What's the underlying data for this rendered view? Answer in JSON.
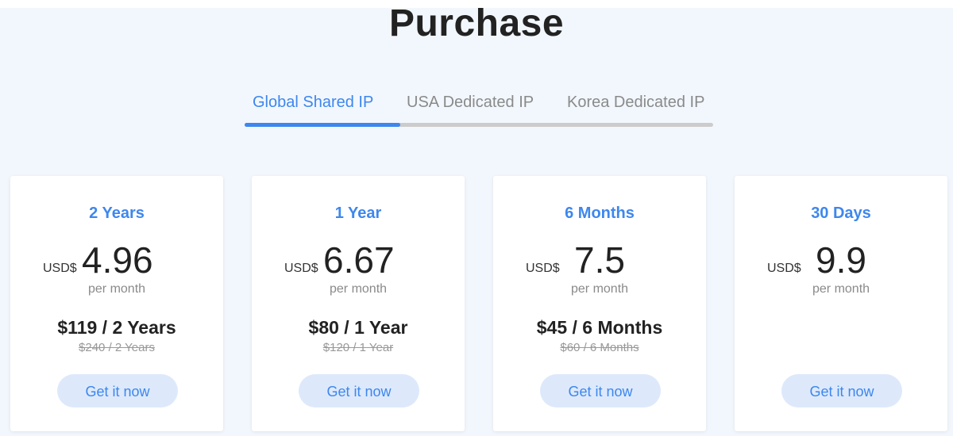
{
  "page": {
    "title": "Purchase"
  },
  "tabs": [
    {
      "label": "Global Shared IP",
      "active": true
    },
    {
      "label": "USA Dedicated IP",
      "active": false
    },
    {
      "label": "Korea Dedicated IP",
      "active": false
    }
  ],
  "colors": {
    "accent": "#3d87ee",
    "button_bg": "#dde9fb",
    "panel_bg": "#f2f7fd"
  },
  "plans": [
    {
      "name": "2 Years",
      "currency": "USD$",
      "amount": "4.96",
      "per": "per month",
      "total": "$119 / 2 Years",
      "original": "$240 / 2 Years",
      "button": "Get it now"
    },
    {
      "name": "1 Year",
      "currency": "USD$",
      "amount": "6.67",
      "per": "per month",
      "total": "$80 / 1 Year",
      "original": "$120 / 1 Year",
      "button": "Get it now"
    },
    {
      "name": "6 Months",
      "currency": "USD$",
      "amount": "7.5",
      "per": "per month",
      "total": "$45 / 6 Months",
      "original": "$60 / 6 Months",
      "button": "Get it now"
    },
    {
      "name": "30 Days",
      "currency": "USD$",
      "amount": "9.9",
      "per": "per month",
      "total": "",
      "original": "",
      "button": "Get it now"
    }
  ]
}
